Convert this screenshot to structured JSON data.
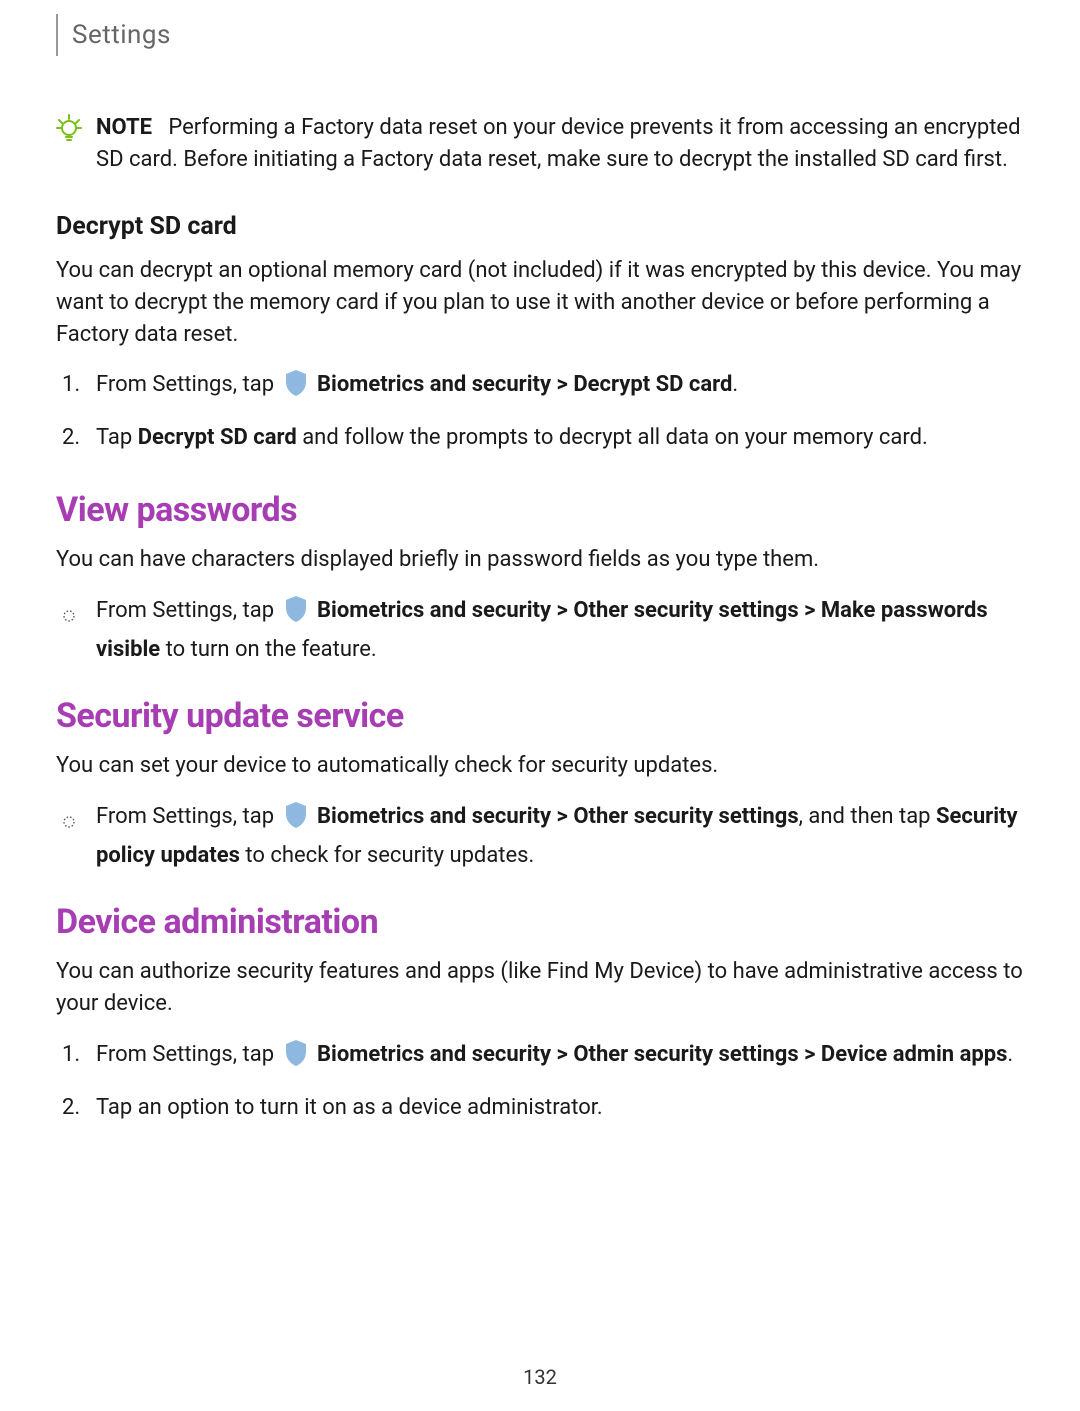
{
  "header": {
    "title": "Settings"
  },
  "note": {
    "label": "NOTE",
    "text": "Performing a Factory data reset on your device prevents it from accessing an encrypted SD card. Before initiating a Factory data reset, make sure to decrypt the installed SD card first."
  },
  "decrypt": {
    "heading": "Decrypt SD card",
    "intro": "You can decrypt an optional memory card (not included) if it was encrypted by this device. You may want to decrypt the memory card if you plan to use it with another device or before performing a Factory data reset.",
    "step1": {
      "prefix": "From Settings, tap ",
      "bold": "Biometrics and security > Decrypt SD card",
      "suffix": "."
    },
    "step2": {
      "prefix": "Tap ",
      "bold1": "Decrypt SD card",
      "rest": " and follow the prompts to decrypt all data on your memory card."
    }
  },
  "viewpass": {
    "heading": "View passwords",
    "intro": "You can have characters displayed briefly in password fields as you type them.",
    "bullet": {
      "prefix": "From Settings, tap ",
      "bold1": "Biometrics and security > Other security settings > Make passwords visible",
      "suffix": " to turn on the feature."
    }
  },
  "security": {
    "heading": "Security update service",
    "intro": "You can set your device to automatically check for security updates.",
    "bullet": {
      "prefix": "From Settings, tap ",
      "bold1": "Biometrics and security > Other security settings",
      "mid": ", and then tap ",
      "bold2": "Security policy updates",
      "suffix": " to check for security updates."
    }
  },
  "admin": {
    "heading": "Device administration",
    "intro": "You can authorize security features and apps (like Find My Device) to have administrative access to your device.",
    "step1": {
      "prefix": "From Settings, tap ",
      "bold": "Biometrics and security > Other security settings > Device admin apps",
      "suffix": "."
    },
    "step2": "Tap an option to turn it on as a device administrator."
  },
  "page_number": "132"
}
